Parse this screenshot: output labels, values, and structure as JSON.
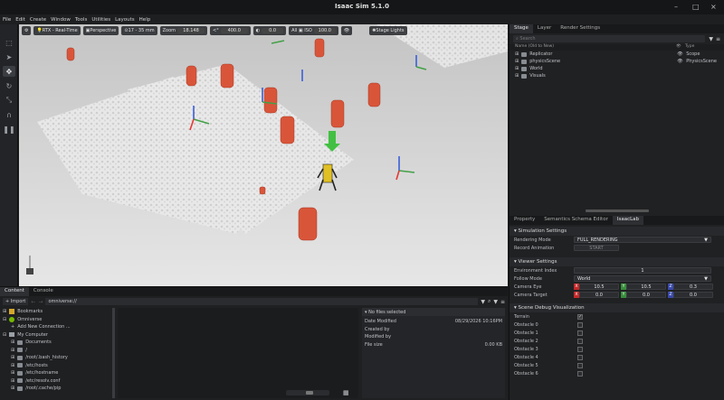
{
  "window": {
    "title": "Isaac Sim 5.1.0"
  },
  "menu": [
    "File",
    "Edit",
    "Create",
    "Window",
    "Tools",
    "Utilities",
    "Layouts",
    "Help"
  ],
  "viewport_toolbar": {
    "renderer": "RTX - Real-Time",
    "camera": "Perspective",
    "lens": "17 - 35 mm",
    "zoom_label": "Zoom",
    "zoom_value": "18.148",
    "angle_value": "400.0",
    "exposure_value": "0.0",
    "all_label": "All",
    "iso_label": "ISO",
    "iso_value": "100.0",
    "stage_lights": "Stage Lights"
  },
  "stage": {
    "tabs": [
      "Stage",
      "Layer",
      "Render Settings"
    ],
    "search_placeholder": "Search",
    "col_name": "Name (Old to New)",
    "col_type": "Type",
    "items": [
      {
        "name": "Replicator",
        "type": "Scope"
      },
      {
        "name": "physicsScene",
        "type": "PhysicsScene"
      },
      {
        "name": "World",
        "type": ""
      },
      {
        "name": "Visuals",
        "type": ""
      }
    ]
  },
  "property": {
    "tabs": [
      "Property",
      "Semantics Schema Editor",
      "IsaacLab"
    ],
    "simulation_settings": "Simulation Settings",
    "rendering_mode_label": "Rendering Mode",
    "rendering_mode_value": "FULL_RENDERING",
    "record_animation_label": "Record Animation",
    "record_animation_value": "START",
    "viewer_settings": "Viewer Settings",
    "env_index_label": "Environment Index",
    "env_index_value": "1",
    "follow_mode_label": "Follow Mode",
    "follow_mode_value": "World",
    "camera_eye_label": "Camera Eye",
    "camera_eye": [
      "10.5",
      "10.5",
      "0.3"
    ],
    "camera_target_label": "Camera Target",
    "camera_target": [
      "0.0",
      "0.0",
      "0.0"
    ],
    "axes": [
      "X",
      "Y",
      "Z"
    ],
    "scene_debug": "Scene Debug Visualization",
    "debug_items": [
      "Terrain",
      "Obstacle 0",
      "Obstacle 1",
      "Obstacle 2",
      "Obstacle 3",
      "Obstacle 4",
      "Obstacle 5",
      "Obstacle 6"
    ]
  },
  "content": {
    "tabs": [
      "Content",
      "Console"
    ],
    "import_label": "Import",
    "path": "omniverse://",
    "tree": [
      {
        "label": "Bookmarks",
        "indent": 0
      },
      {
        "label": "Omniverse",
        "indent": 0
      },
      {
        "label": "Add New Connection ...",
        "indent": 1
      },
      {
        "label": "My Computer",
        "indent": 0
      },
      {
        "label": "Documents",
        "indent": 1
      },
      {
        "label": "/",
        "indent": 1
      },
      {
        "label": "/root/.bash_history",
        "indent": 1
      },
      {
        "label": "/etc/hosts",
        "indent": 1
      },
      {
        "label": "/etc/hostname",
        "indent": 1
      },
      {
        "label": "/etc/resolv.conf",
        "indent": 1
      },
      {
        "label": "/root/.cache/pip",
        "indent": 1
      }
    ],
    "no_files": "No files selected",
    "details": [
      {
        "label": "Date Modified",
        "value": "08/29/2026 10:16PM"
      },
      {
        "label": "Created by",
        "value": ""
      },
      {
        "label": "Modified by",
        "value": ""
      },
      {
        "label": "File size",
        "value": "0.00 KB"
      }
    ]
  },
  "colors": {
    "accent": "#76b900",
    "obstacle": "#d9553a",
    "axis_x": "#e53935",
    "axis_y": "#43a047",
    "axis_z": "#3a5fd9"
  }
}
